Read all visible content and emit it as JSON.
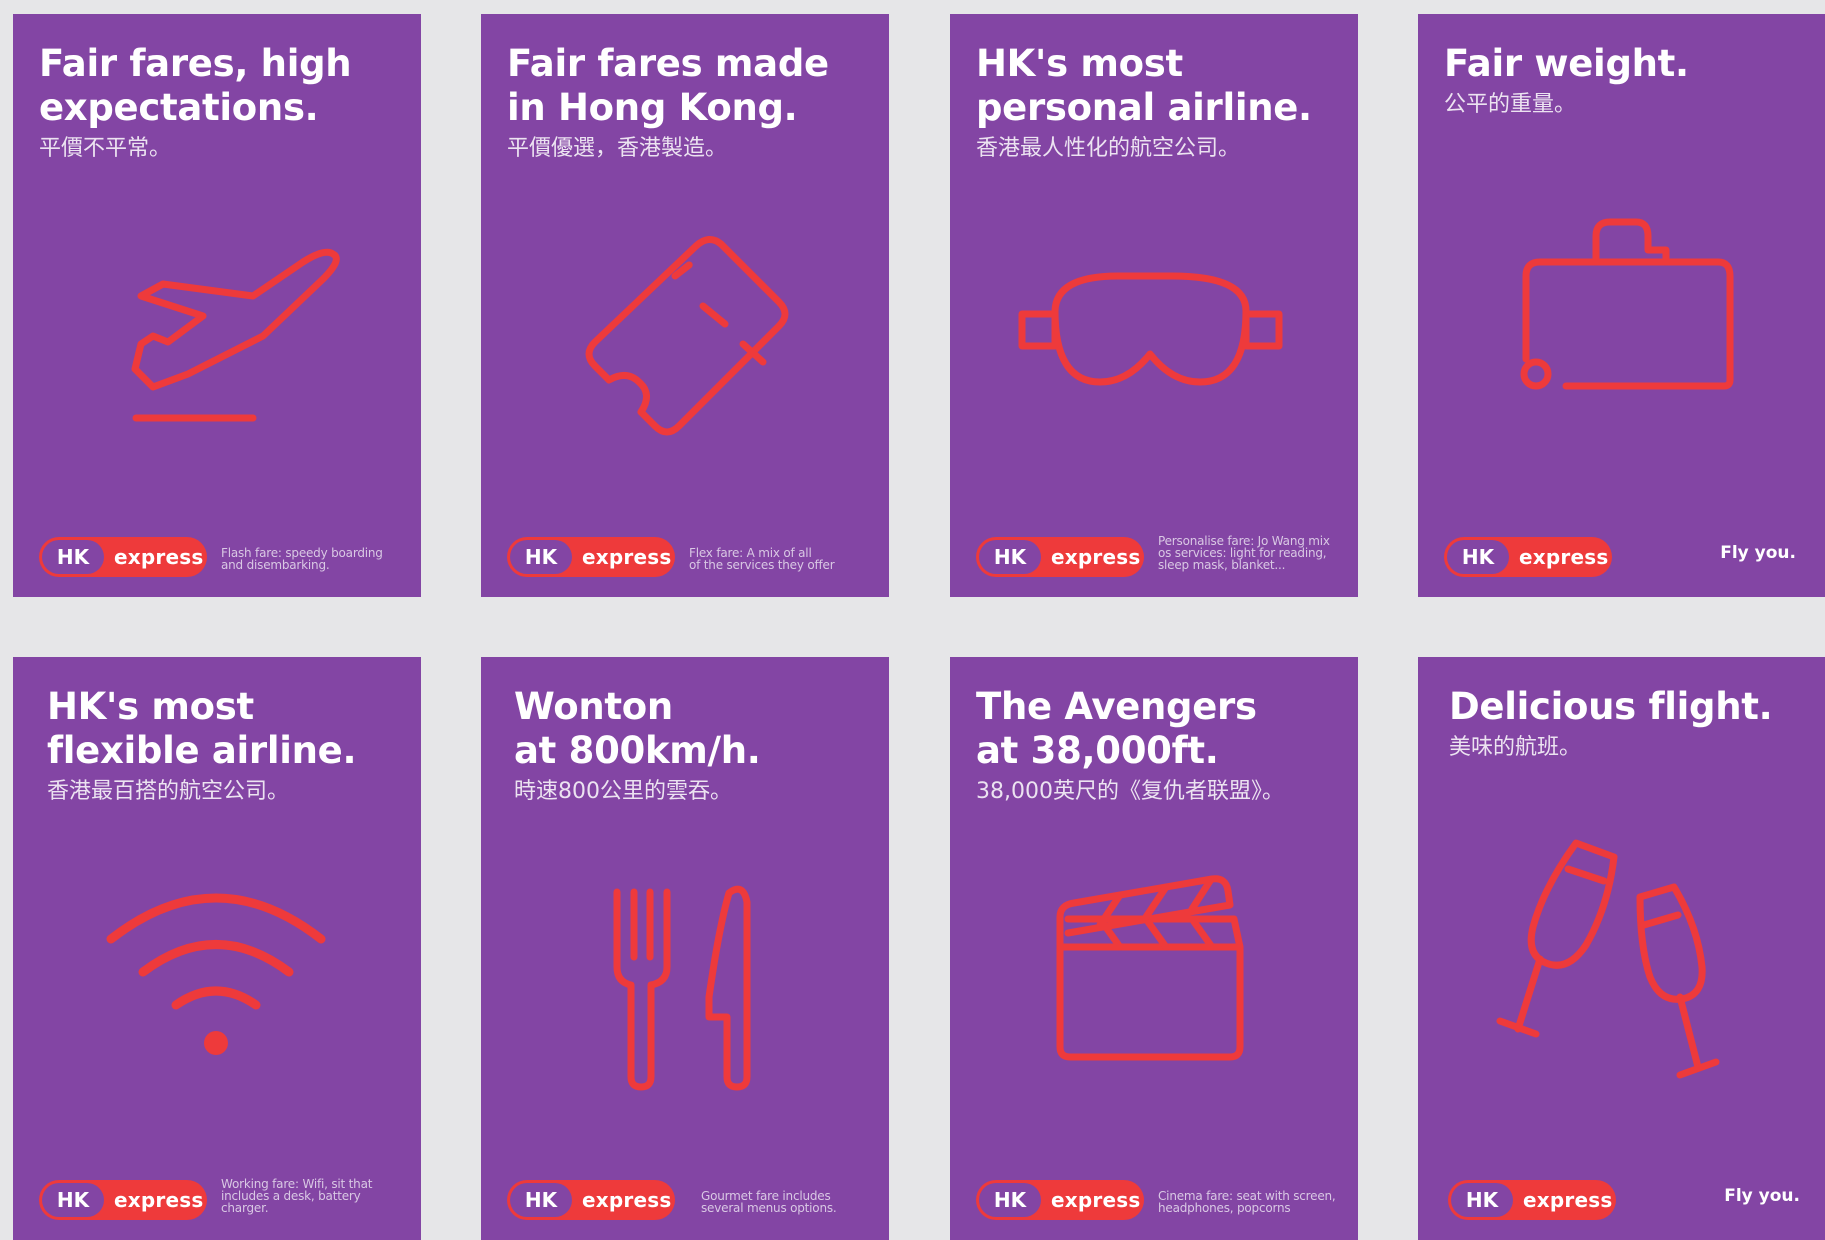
{
  "brand": {
    "hk": "HK",
    "express": "express",
    "accent": "#ee3a3b",
    "purple": "#8345a4",
    "background": "#e6e6e8"
  },
  "posters": [
    {
      "title": "Fair fares, high\nexpectations.",
      "subtitle": "平價不平常。",
      "fare": "Flash fare: speedy boarding\nand disembarking.",
      "icon": "plane-takeoff-icon"
    },
    {
      "title": "Fair fares made\nin Hong Kong.",
      "subtitle": "平價優選，香港製造。",
      "fare": "Flex fare: A mix of all\nof the services they offer",
      "icon": "ticket-icon"
    },
    {
      "title": "HK's most\npersonal airline.",
      "subtitle": "香港最人性化的航空公司。",
      "fare": "Personalise fare: Jo Wang mix\nos services: light for reading,\nsleep mask, blanket...",
      "icon": "sleep-mask-icon"
    },
    {
      "title": "Fair weight.",
      "subtitle": "公平的重量。",
      "fly": "Fly you.",
      "icon": "suitcase-icon"
    },
    {
      "title": "HK's most\nflexible airline.",
      "subtitle": "香港最百搭的航空公司。",
      "fare": "Working fare: Wifi, sit that\nincludes a desk, battery charger.",
      "icon": "wifi-icon"
    },
    {
      "title": "Wonton\nat 800km/h.",
      "subtitle": "時速800公里的雲吞。",
      "fare": "Gourmet fare includes\nseveral menus options.",
      "icon": "fork-knife-icon"
    },
    {
      "title": "The Avengers\nat 38,000ft.",
      "subtitle": "38,000英尺的《复仇者联盟》。",
      "fare": "Cinema fare: seat with screen,\nheadphones, popcorns",
      "icon": "clapperboard-icon"
    },
    {
      "title": "Delicious flight.",
      "subtitle": "美味的航班。",
      "fly": "Fly you.",
      "icon": "champagne-glasses-icon"
    }
  ]
}
